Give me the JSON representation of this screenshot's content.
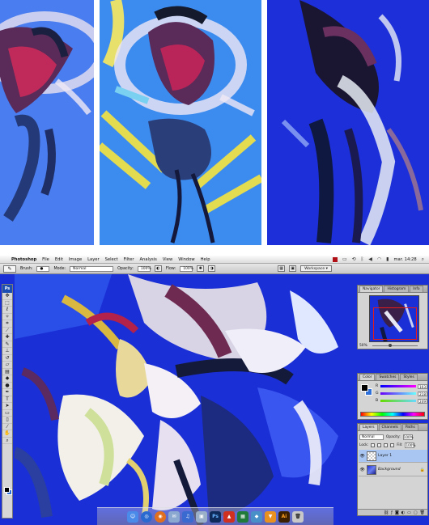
{
  "menubar": {
    "apple": "",
    "app_name": "Photoshop",
    "items": [
      "File",
      "Edit",
      "Image",
      "Layer",
      "Select",
      "Filter",
      "Analysis",
      "View",
      "Window",
      "Help"
    ],
    "clock": "mar. 14:28"
  },
  "options_bar": {
    "brush_label": "Brush:",
    "mode_label": "Mode:",
    "mode_value": "Normal",
    "opacity_label": "Opacity:",
    "opacity_value": "100%",
    "flow_label": "Flow:",
    "flow_value": "100%",
    "workspace_label": "Workspace"
  },
  "toolbox": {
    "logo": "Ps",
    "tools": [
      "move-icon",
      "marquee-icon",
      "lasso-icon",
      "magic-wand-icon",
      "crop-icon",
      "slice-icon",
      "healing-icon",
      "brush-icon",
      "stamp-icon",
      "history-brush-icon",
      "eraser-icon",
      "gradient-icon",
      "blur-icon",
      "dodge-icon",
      "pen-icon",
      "type-icon",
      "path-select-icon",
      "shape-icon",
      "notes-icon",
      "eyedropper-icon",
      "hand-icon",
      "zoom-icon"
    ]
  },
  "navigator": {
    "tabs": [
      "Navigator",
      "Histogram",
      "Info"
    ],
    "zoom": "50%"
  },
  "color_palette": {
    "tabs": [
      "Color",
      "Swatches",
      "Styles"
    ],
    "rows": [
      {
        "letter": "R",
        "value": "103"
      },
      {
        "letter": "G",
        "value": "218"
      },
      {
        "letter": "B",
        "value": "249"
      }
    ]
  },
  "layers_palette": {
    "tabs": [
      "Layers",
      "Channels",
      "Paths"
    ],
    "blend_mode": "Normal",
    "opacity_label": "Opacity:",
    "opacity_value": "100%",
    "lock_label": "Lock:",
    "fill_label": "Fill:",
    "fill_value": "100%",
    "layers": [
      {
        "name": "Layer 1",
        "selected": true
      },
      {
        "name": "Background",
        "selected": false
      }
    ]
  },
  "dock": {
    "icons": [
      "finder-icon",
      "safari-icon",
      "firefox-icon",
      "mail-icon",
      "itunes-icon",
      "preview-icon",
      "photoshop-icon",
      "app-icon",
      "app-icon-2",
      "app-icon-3",
      "illustrator-icon",
      "app-icon-4",
      "trash-icon"
    ],
    "ps_label": "Ps",
    "ai_label": "Ai"
  },
  "colors": {
    "canvas_blue": "#1a2fd6",
    "panel_light_blue": "#4a7df0",
    "selection_blue": "#a9c6f2"
  }
}
